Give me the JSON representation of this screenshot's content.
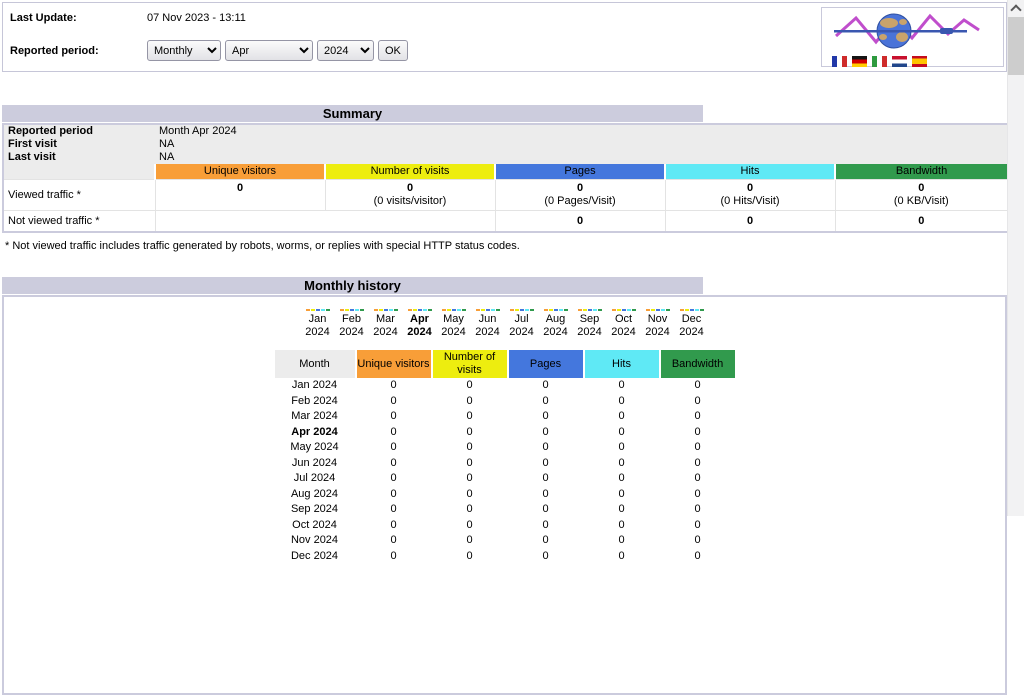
{
  "header": {
    "last_update_label": "Last Update:",
    "last_update_value": "07 Nov 2023 - 13:11",
    "reported_period_label": "Reported period:",
    "period_select": "Monthly",
    "month_select": "Apr",
    "year_select": "2024",
    "ok_label": "OK",
    "logo": {
      "name": "awstats-logo",
      "flags": [
        "fr",
        "de",
        "it",
        "nl",
        "es"
      ]
    }
  },
  "summary": {
    "title": "Summary",
    "info_rows": [
      {
        "label": "Reported period",
        "value": "Month Apr 2024"
      },
      {
        "label": "First visit",
        "value": "NA"
      },
      {
        "label": "Last visit",
        "value": "NA"
      }
    ],
    "columns": [
      {
        "label": "Unique visitors",
        "color": "#F89E38"
      },
      {
        "label": "Number of visits",
        "color": "#EDED0F"
      },
      {
        "label": "Pages",
        "color": "#4477DD"
      },
      {
        "label": "Hits",
        "color": "#5FE9F5"
      },
      {
        "label": "Bandwidth",
        "color": "#319A4D"
      }
    ],
    "viewed_row": {
      "label": "Viewed traffic *",
      "values": [
        "0",
        "0",
        "0",
        "0",
        "0"
      ],
      "subvalues": [
        "",
        "(0 visits/visitor)",
        "(0 Pages/Visit)",
        "(0 Hits/Visit)",
        "(0 KB/Visit)"
      ]
    },
    "not_viewed_row": {
      "label": "Not viewed traffic *",
      "values": [
        "0",
        "0",
        "0"
      ]
    },
    "footnote": "* Not viewed traffic includes traffic generated by robots, worms, or replies with special HTTP status codes."
  },
  "monthly": {
    "title": "Monthly history",
    "chart_data": {
      "type": "bar",
      "title": "Monthly history",
      "categories": [
        "Jan 2024",
        "Feb 2024",
        "Mar 2024",
        "Apr 2024",
        "May 2024",
        "Jun 2024",
        "Jul 2024",
        "Aug 2024",
        "Sep 2024",
        "Oct 2024",
        "Nov 2024",
        "Dec 2024"
      ],
      "series": [
        {
          "name": "Unique visitors",
          "color": "#F89E38",
          "values": [
            0,
            0,
            0,
            0,
            0,
            0,
            0,
            0,
            0,
            0,
            0,
            0
          ]
        },
        {
          "name": "Number of visits",
          "color": "#EDED0F",
          "values": [
            0,
            0,
            0,
            0,
            0,
            0,
            0,
            0,
            0,
            0,
            0,
            0
          ]
        },
        {
          "name": "Pages",
          "color": "#4477DD",
          "values": [
            0,
            0,
            0,
            0,
            0,
            0,
            0,
            0,
            0,
            0,
            0,
            0
          ]
        },
        {
          "name": "Hits",
          "color": "#5FE9F5",
          "values": [
            0,
            0,
            0,
            0,
            0,
            0,
            0,
            0,
            0,
            0,
            0,
            0
          ]
        },
        {
          "name": "Bandwidth",
          "color": "#319A4D",
          "values": [
            0,
            0,
            0,
            0,
            0,
            0,
            0,
            0,
            0,
            0,
            0,
            0
          ]
        }
      ],
      "ylim": [
        0,
        1
      ],
      "grid": false,
      "legend_position": "none",
      "highlighted_category": "Apr 2024"
    },
    "months": [
      {
        "name": "Jan",
        "year": "2024",
        "bold": false
      },
      {
        "name": "Feb",
        "year": "2024",
        "bold": false
      },
      {
        "name": "Mar",
        "year": "2024",
        "bold": false
      },
      {
        "name": "Apr",
        "year": "2024",
        "bold": true
      },
      {
        "name": "May",
        "year": "2024",
        "bold": false
      },
      {
        "name": "Jun",
        "year": "2024",
        "bold": false
      },
      {
        "name": "Jul",
        "year": "2024",
        "bold": false
      },
      {
        "name": "Aug",
        "year": "2024",
        "bold": false
      },
      {
        "name": "Sep",
        "year": "2024",
        "bold": false
      },
      {
        "name": "Oct",
        "year": "2024",
        "bold": false
      },
      {
        "name": "Nov",
        "year": "2024",
        "bold": false
      },
      {
        "name": "Dec",
        "year": "2024",
        "bold": false
      }
    ],
    "table": {
      "headers": [
        "Month",
        "Unique visitors",
        "Number of visits",
        "Pages",
        "Hits",
        "Bandwidth"
      ],
      "rows": [
        {
          "month": "Jan 2024",
          "bold": false,
          "values": [
            "0",
            "0",
            "0",
            "0",
            "0"
          ]
        },
        {
          "month": "Feb 2024",
          "bold": false,
          "values": [
            "0",
            "0",
            "0",
            "0",
            "0"
          ]
        },
        {
          "month": "Mar 2024",
          "bold": false,
          "values": [
            "0",
            "0",
            "0",
            "0",
            "0"
          ]
        },
        {
          "month": "Apr 2024",
          "bold": true,
          "values": [
            "0",
            "0",
            "0",
            "0",
            "0"
          ]
        },
        {
          "month": "May 2024",
          "bold": false,
          "values": [
            "0",
            "0",
            "0",
            "0",
            "0"
          ]
        },
        {
          "month": "Jun 2024",
          "bold": false,
          "values": [
            "0",
            "0",
            "0",
            "0",
            "0"
          ]
        },
        {
          "month": "Jul 2024",
          "bold": false,
          "values": [
            "0",
            "0",
            "0",
            "0",
            "0"
          ]
        },
        {
          "month": "Aug 2024",
          "bold": false,
          "values": [
            "0",
            "0",
            "0",
            "0",
            "0"
          ]
        },
        {
          "month": "Sep 2024",
          "bold": false,
          "values": [
            "0",
            "0",
            "0",
            "0",
            "0"
          ]
        },
        {
          "month": "Oct 2024",
          "bold": false,
          "values": [
            "0",
            "0",
            "0",
            "0",
            "0"
          ]
        },
        {
          "month": "Nov 2024",
          "bold": false,
          "values": [
            "0",
            "0",
            "0",
            "0",
            "0"
          ]
        },
        {
          "month": "Dec 2024",
          "bold": false,
          "values": [
            "0",
            "0",
            "0",
            "0",
            "0"
          ]
        }
      ]
    }
  }
}
